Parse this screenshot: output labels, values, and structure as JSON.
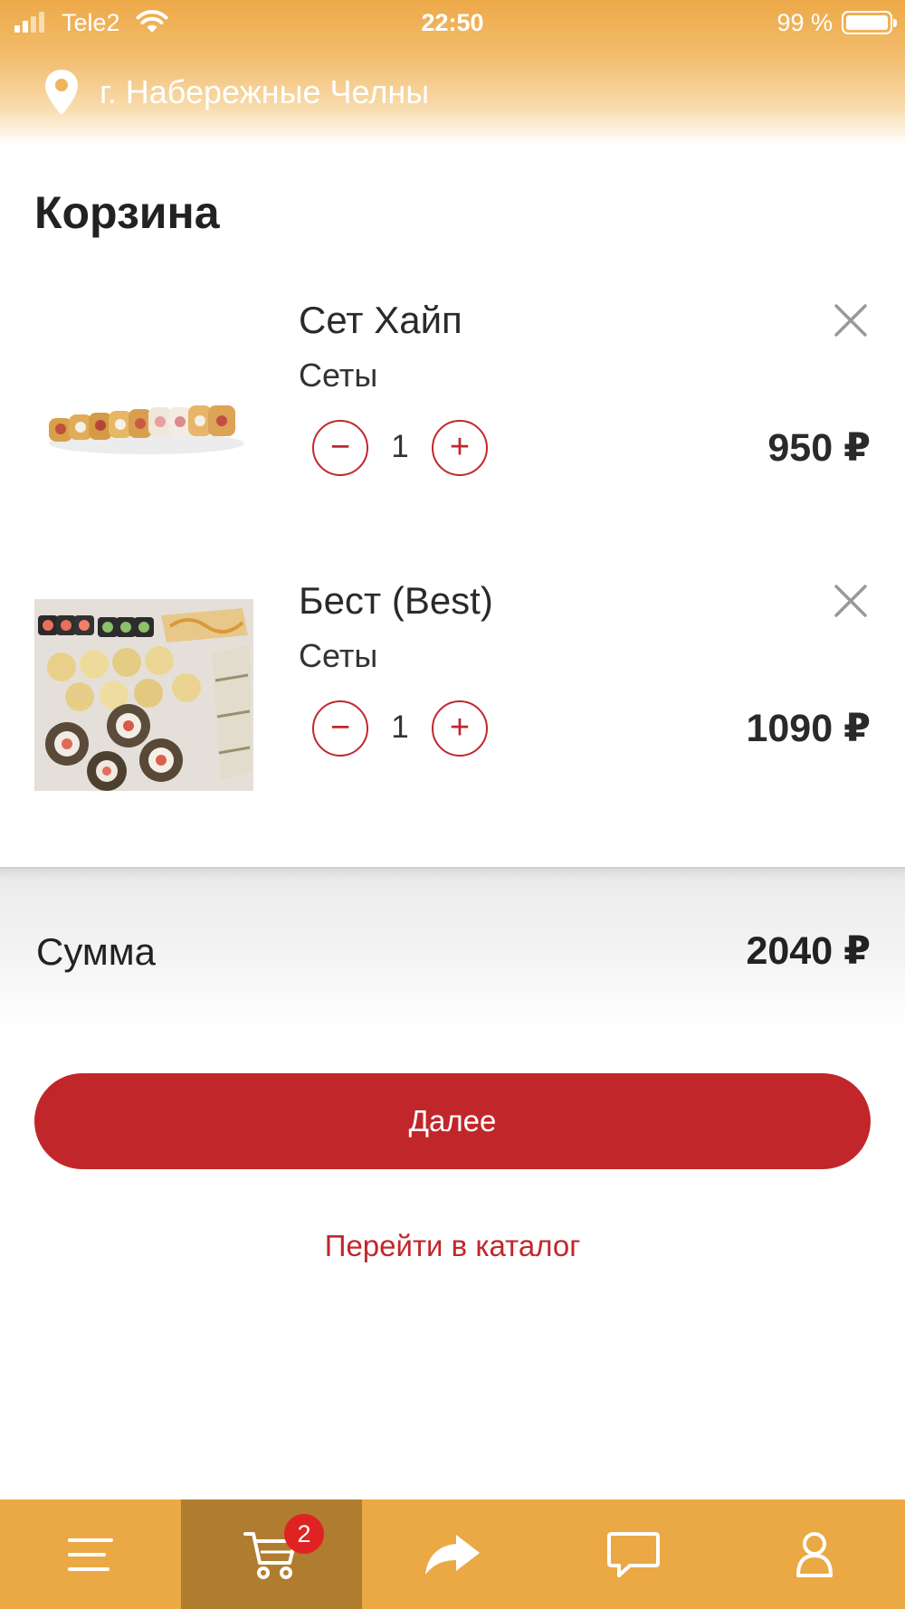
{
  "status_bar": {
    "carrier": "Tele2",
    "time": "22:50",
    "battery_percent": "99 %"
  },
  "header": {
    "location": "г. Набережные Челны"
  },
  "page": {
    "title": "Корзина"
  },
  "cart": {
    "items": [
      {
        "name": "Сет Хайп",
        "category": "Сеты",
        "quantity": "1",
        "price": "950 ₽",
        "minus": "−",
        "plus": "+"
      },
      {
        "name": "Бест (Best)",
        "category": "Сеты",
        "quantity": "1",
        "price": "1090 ₽",
        "minus": "−",
        "plus": "+"
      }
    ]
  },
  "summary": {
    "label": "Сумма",
    "total": "2040 ₽"
  },
  "actions": {
    "next_label": "Далее",
    "catalog_label": "Перейти в каталог"
  },
  "tabbar": {
    "tabs": [
      {
        "icon": "menu-icon",
        "active": false
      },
      {
        "icon": "cart-icon",
        "active": true,
        "badge": "2"
      },
      {
        "icon": "share-icon",
        "active": false
      },
      {
        "icon": "chat-icon",
        "active": false
      },
      {
        "icon": "user-icon",
        "active": false
      }
    ]
  },
  "colors": {
    "accent": "#c1272a",
    "header": "#eda948",
    "tabbar": "#eaa944",
    "tab_active": "#b07c30",
    "badge": "#e02222"
  }
}
